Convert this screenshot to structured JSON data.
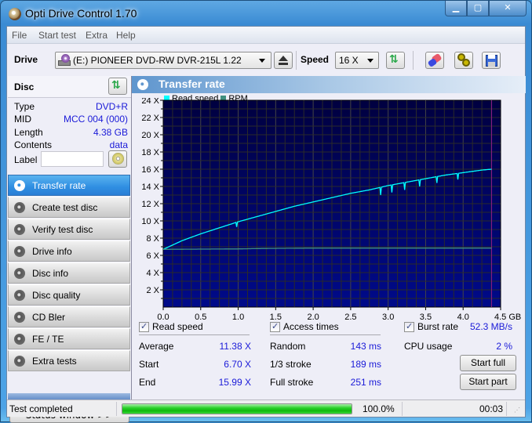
{
  "window": {
    "title": "Opti Drive Control 1.70",
    "controls": [
      "minimize",
      "maximize",
      "close"
    ]
  },
  "menu": [
    "File",
    "Start test",
    "Extra",
    "Help"
  ],
  "toolbar": {
    "drive_label": "Drive",
    "drive_value": "(E:)  PIONEER DVD-RW  DVR-215L 1.22",
    "speed_label": "Speed",
    "speed_value": "16 X",
    "icons": [
      "eject-icon",
      "refresh-icon",
      "eraser-icon",
      "settings-icon",
      "save-icon"
    ]
  },
  "disc": {
    "title": "Disc",
    "rows": [
      {
        "label": "Type",
        "value": "DVD+R"
      },
      {
        "label": "MID",
        "value": "MCC 004 (000)"
      },
      {
        "label": "Length",
        "value": "4.38 GB"
      },
      {
        "label": "Contents",
        "value": "data"
      }
    ],
    "label_field_label": "Label",
    "label_field_value": ""
  },
  "nav": [
    {
      "label": "Transfer rate",
      "active": true
    },
    {
      "label": "Create test disc",
      "active": false
    },
    {
      "label": "Verify test disc",
      "active": false
    },
    {
      "label": "Drive info",
      "active": false
    },
    {
      "label": "Disc info",
      "active": false
    },
    {
      "label": "Disc quality",
      "active": false
    },
    {
      "label": "CD Bler",
      "active": false
    },
    {
      "label": "FE / TE",
      "active": false
    },
    {
      "label": "Extra tests",
      "active": false
    }
  ],
  "status_window_button": "Status window >>",
  "panel": {
    "title": "Transfer rate",
    "legend": [
      {
        "label": "Read speed",
        "color": "#00ffff"
      },
      {
        "label": "RPM",
        "color": "#3f8f7f"
      }
    ]
  },
  "chart_data": {
    "type": "line",
    "title": "Transfer rate",
    "xlabel": "GB",
    "ylabel": "X",
    "xlim": [
      0,
      4.5
    ],
    "ylim": [
      0,
      24
    ],
    "x_ticks": [
      "0.0",
      "0.5",
      "1.0",
      "1.5",
      "2.0",
      "2.5",
      "3.0",
      "3.5",
      "4.0",
      "4.5 GB"
    ],
    "y_ticks": [
      "2 X",
      "4 X",
      "6 X",
      "8 X",
      "10 X",
      "12 X",
      "14 X",
      "16 X",
      "18 X",
      "20 X",
      "22 X",
      "24 X"
    ],
    "grid": true,
    "background": "#000060",
    "end_marker_x": 4.38,
    "series": [
      {
        "name": "Read speed",
        "color": "#00ffff",
        "x": [
          0.0,
          0.25,
          0.5,
          0.75,
          1.0,
          1.25,
          1.5,
          1.75,
          2.0,
          2.25,
          2.5,
          2.75,
          3.0,
          3.25,
          3.5,
          3.75,
          4.0,
          4.25,
          4.38
        ],
        "y": [
          6.7,
          7.7,
          8.5,
          9.2,
          9.9,
          10.5,
          11.1,
          11.7,
          12.2,
          12.7,
          13.2,
          13.6,
          14.1,
          14.5,
          14.9,
          15.3,
          15.6,
          15.9,
          16.0
        ],
        "dips": [
          {
            "x": 0.98,
            "y": 9.3
          },
          {
            "x": 2.9,
            "y": 13.0
          },
          {
            "x": 3.05,
            "y": 13.3
          },
          {
            "x": 3.22,
            "y": 13.6
          },
          {
            "x": 3.42,
            "y": 14.0
          },
          {
            "x": 3.65,
            "y": 14.4
          },
          {
            "x": 3.93,
            "y": 14.8
          }
        ]
      },
      {
        "name": "RPM",
        "color": "#3f8f7f",
        "x": [
          0.0,
          1.0,
          1.33,
          2.0,
          3.0,
          4.0,
          4.38
        ],
        "y": [
          6.7,
          6.75,
          6.8,
          6.85,
          6.85,
          6.85,
          6.85
        ]
      }
    ]
  },
  "read_speed": {
    "checkbox_label": "Read speed",
    "checked": true,
    "rows": [
      {
        "label": "Average",
        "value": "11.38 X"
      },
      {
        "label": "Start",
        "value": "6.70 X"
      },
      {
        "label": "End",
        "value": "15.99 X"
      }
    ]
  },
  "access_times": {
    "checkbox_label": "Access times",
    "checked": true,
    "rows": [
      {
        "label": "Random",
        "value": "143 ms"
      },
      {
        "label": "1/3 stroke",
        "value": "189 ms"
      },
      {
        "label": "Full stroke",
        "value": "251 ms"
      }
    ]
  },
  "burst": {
    "checkbox_label": "Burst rate",
    "checked": true,
    "value": "52.3 MB/s",
    "cpu_label": "CPU usage",
    "cpu_value": "2 %"
  },
  "buttons": {
    "start_full": "Start full",
    "start_part": "Start part"
  },
  "statusbar": {
    "status": "Test completed",
    "progress_percent": 100.0,
    "progress_text": "100.0%",
    "elapsed": "00:03"
  }
}
